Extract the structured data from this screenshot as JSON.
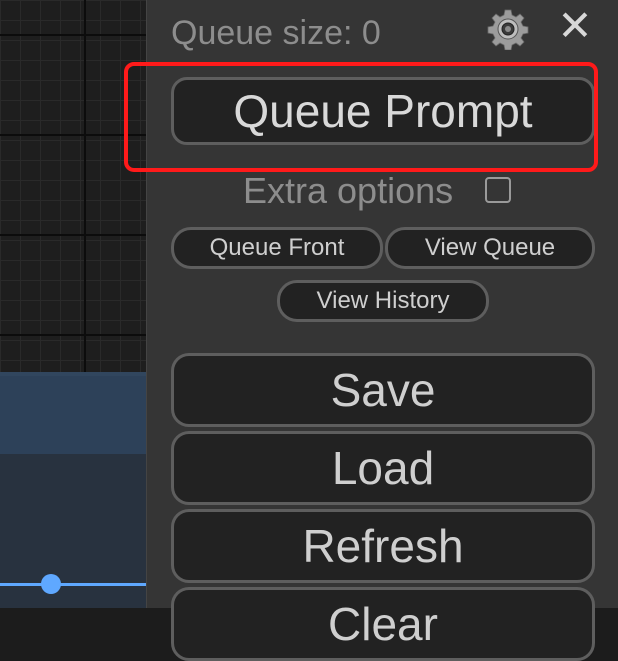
{
  "menu": {
    "queue_size_label": "Queue size: 0",
    "queue_prompt": "Queue Prompt",
    "extra_options": "Extra options",
    "extra_options_checked": false,
    "queue_front": "Queue Front",
    "view_queue": "View Queue",
    "view_history": "View History",
    "save": "Save",
    "load": "Load",
    "refresh": "Refresh",
    "clear": "Clear",
    "close_glyph": "✕"
  },
  "icons": {
    "settings": "gear-icon",
    "close": "close-icon"
  },
  "colors": {
    "panel_bg": "#353535",
    "button_bg": "#222222",
    "button_border": "#5e5e5e",
    "highlight": "#ff1a1a",
    "wire": "#5fa8ff"
  }
}
